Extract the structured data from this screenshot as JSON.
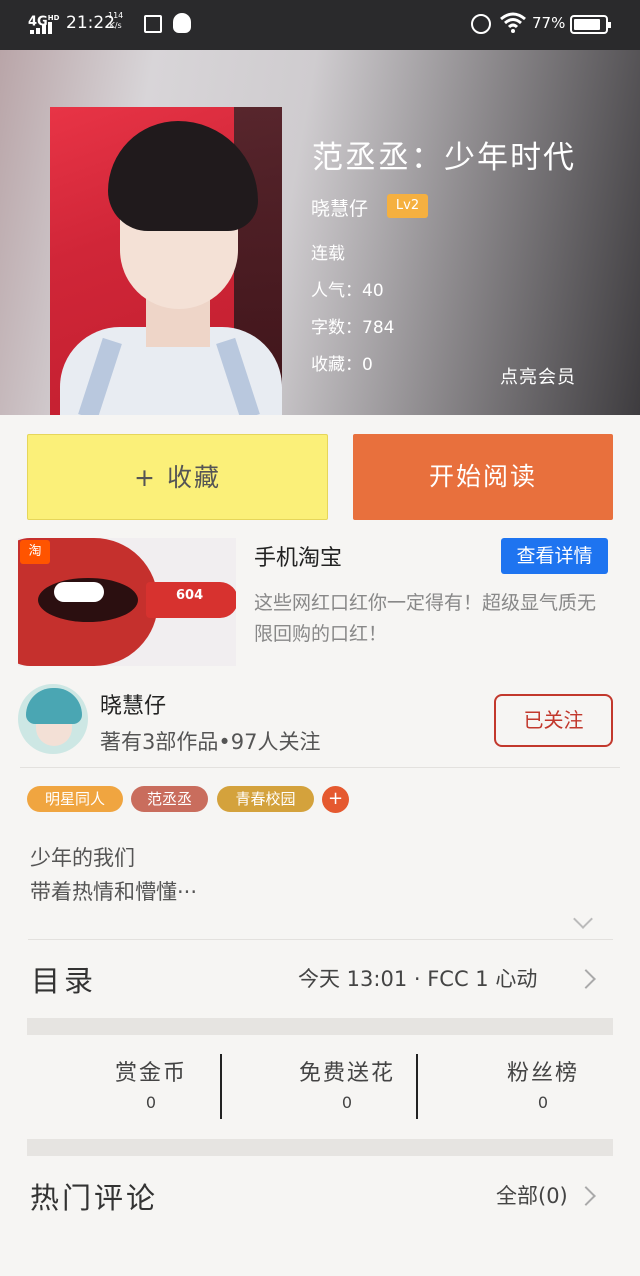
{
  "status_bar": {
    "network": "4G",
    "network_sup": "HD",
    "time": "21:22",
    "speed_value": "114",
    "speed_unit": "K/s",
    "battery": "77%"
  },
  "book": {
    "title": "范丞丞：少年时代",
    "author": "晓慧仔",
    "author_level": "Lv2",
    "status": "连载",
    "popularity": "人气：40",
    "word_count": "字数：784",
    "favorites": "收藏：0",
    "vip_link": "点亮会员"
  },
  "actions": {
    "favorite_label": "+ 收藏",
    "read_label": "开始阅读"
  },
  "ad": {
    "badge": "淘",
    "product_code": "604",
    "title": "手机淘宝",
    "detail_button": "查看详情",
    "description": "这些网红口红你一定得有！超级显气质无限回购的口红！"
  },
  "author_card": {
    "name": "晓慧仔",
    "stats": "著有3部作品•97人关注",
    "follow_label": "已关注"
  },
  "tags": [
    {
      "label": "明星同人",
      "color": "#f0a540"
    },
    {
      "label": "范丞丞",
      "color": "#c96d5d"
    },
    {
      "label": "青春校园",
      "color": "#d4a23c"
    }
  ],
  "tag_add": "+",
  "intro": {
    "line1": "少年的我们",
    "line2": "带着热情和懵懂···"
  },
  "catalog": {
    "title": "目录",
    "latest": "今天 13:01 · FCC 1 心动"
  },
  "stats": [
    {
      "label": "赏金币",
      "value": "0"
    },
    {
      "label": "免费送花",
      "value": "0"
    },
    {
      "label": "粉丝榜",
      "value": "0"
    }
  ],
  "comments": {
    "title": "热门评论",
    "all_label": "全部(0)"
  },
  "colors": {
    "favorite_bg": "#fbf079",
    "read_bg": "#e8703d",
    "detail_btn": "#1e74f0",
    "follow": "#c2382c",
    "level_badge": "#f5b040"
  }
}
